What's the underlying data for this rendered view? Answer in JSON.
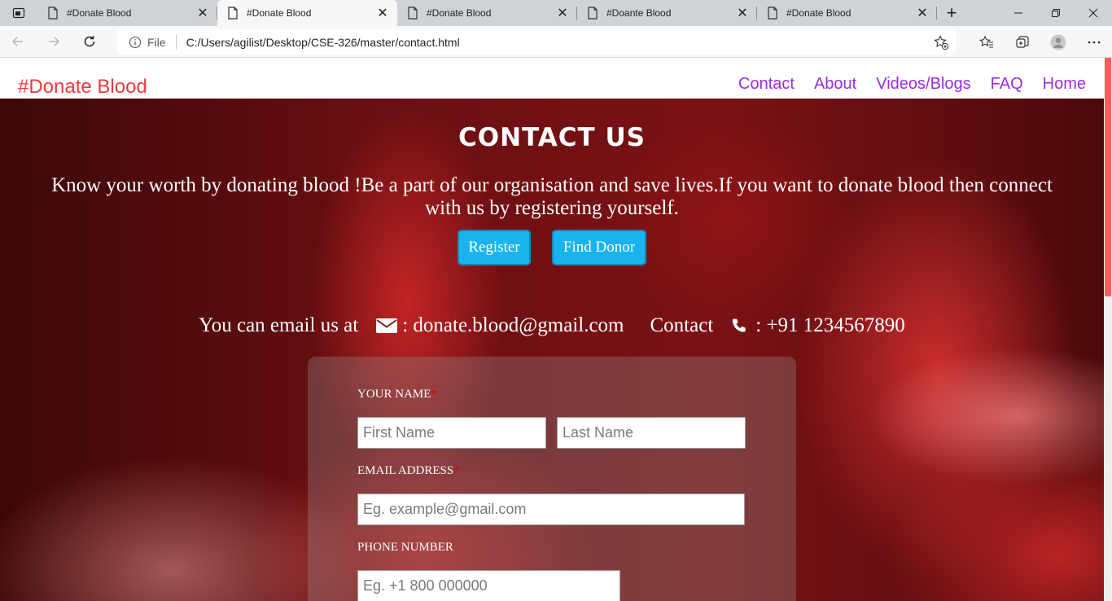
{
  "browser": {
    "tabs": [
      {
        "title": "#Donate Blood",
        "active": false
      },
      {
        "title": "#Donate Blood",
        "active": true
      },
      {
        "title": "#Donate Blood",
        "active": false
      },
      {
        "title": "#Doante Blood",
        "active": false
      },
      {
        "title": "#Donate Blood",
        "active": false
      }
    ],
    "address": {
      "scheme_label": "File",
      "url": "C:/Users/agilist/Desktop/CSE-326/master/contact.html"
    }
  },
  "site": {
    "brand": "#Donate Blood",
    "menu": [
      "Contact",
      "About",
      "Videos/Blogs",
      "FAQ",
      "Home"
    ],
    "colors": {
      "brand": "#ee3b3b",
      "menu": "#9a2de0",
      "button": "#19b4ee",
      "required": "#e60000"
    }
  },
  "hero": {
    "title": "CONTACT US",
    "text": "Know your worth by donating blood !Be a part of our organisation and save lives.If you want to donate blood then connect with us by registering yourself.",
    "buttons": {
      "register": "Register",
      "find_donor": "Find Donor"
    },
    "email_prefix": "You can email us at",
    "email": ": donate.blood@gmail.com",
    "contact_label": "Contact",
    "phone": ": +91 1234567890"
  },
  "form": {
    "name_label": "YOUR NAME",
    "required_mark": "*",
    "first_name_placeholder": "First Name",
    "last_name_placeholder": "Last Name",
    "email_label": "EMAIL ADDRESS",
    "email_placeholder": "Eg. example@gmail.com",
    "phone_label": "PHONE NUMBER",
    "phone_placeholder": "Eg. +1 800 000000"
  },
  "icons": [
    "tab-actions-icon",
    "document-icon",
    "close-icon",
    "plus-icon",
    "minimize-icon",
    "restore-icon",
    "back-icon",
    "forward-icon",
    "refresh-icon",
    "info-icon",
    "add-favorite-icon",
    "favorites-icon",
    "collections-icon",
    "profile-icon",
    "more-icon",
    "envelope-icon",
    "phone-icon"
  ]
}
